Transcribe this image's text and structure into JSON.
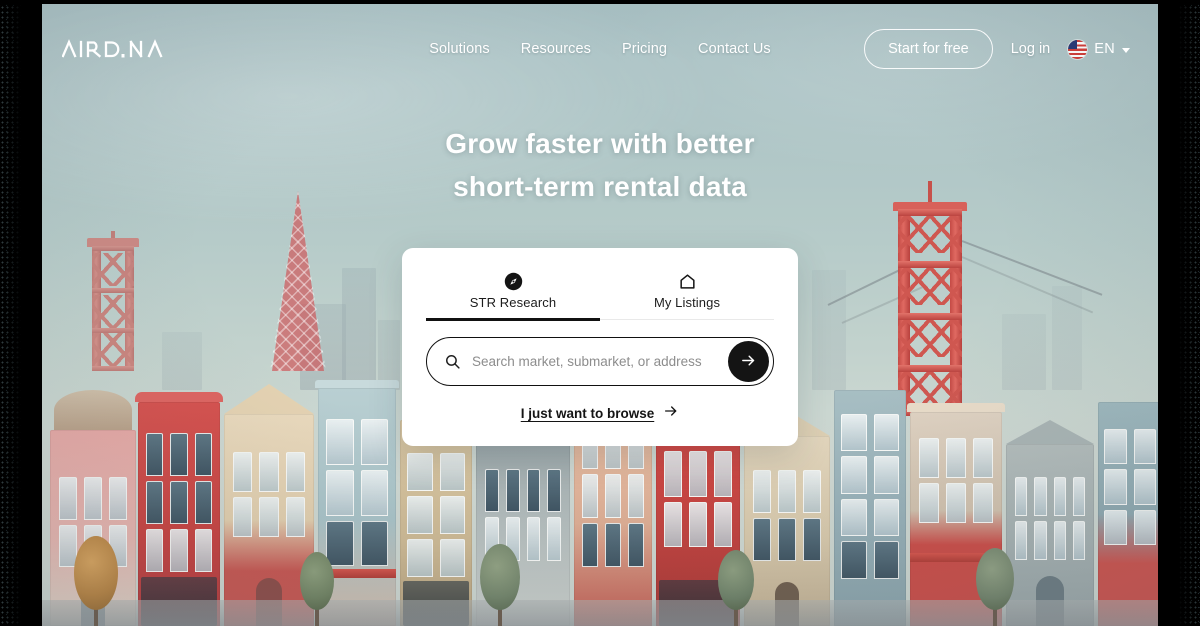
{
  "brand": {
    "logo_text": "AIRDNA"
  },
  "header": {
    "nav": [
      {
        "label": "Solutions",
        "name": "nav-solutions"
      },
      {
        "label": "Resources",
        "name": "nav-resources"
      },
      {
        "label": "Pricing",
        "name": "nav-pricing"
      },
      {
        "label": "Contact Us",
        "name": "nav-contact-us"
      }
    ],
    "start_for_free_label": "Start for free",
    "login_label": "Log in",
    "language": {
      "code": "EN",
      "flag": "us-flag-icon",
      "caret": "chevron-down-icon"
    }
  },
  "hero": {
    "headline_line1": "Grow faster with better",
    "headline_line2": "short-term rental data"
  },
  "search_card": {
    "tabs": [
      {
        "label": "STR Research",
        "icon": "compass-icon",
        "active": true
      },
      {
        "label": "My Listings",
        "icon": "home-icon",
        "active": false
      }
    ],
    "search": {
      "placeholder": "Search market, submarket, or address",
      "value": "",
      "icon": "search-icon",
      "submit_icon": "arrow-right-icon"
    },
    "browse": {
      "label": "I just want to browse",
      "icon": "arrow-right-icon"
    }
  },
  "colors": {
    "sky": "#b0c6c7",
    "accent_dark": "#141414",
    "bridge_red": "#c9504a",
    "card_background": "#ffffff",
    "text_on_hero": "#ffffff"
  }
}
